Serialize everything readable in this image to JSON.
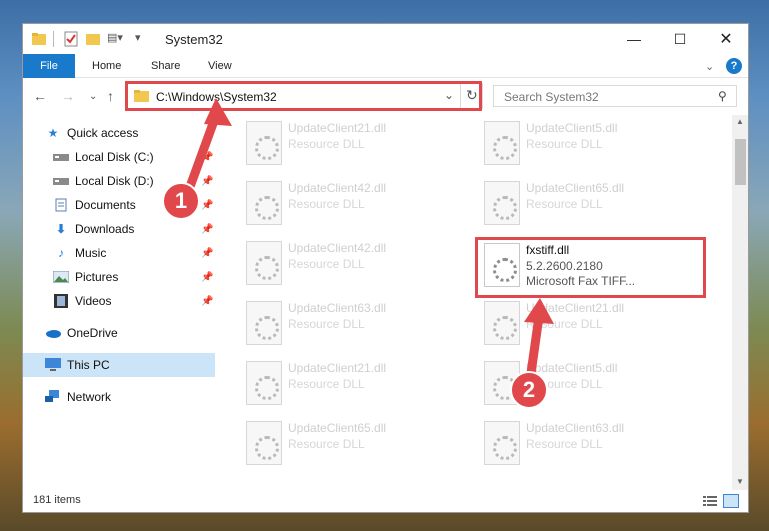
{
  "window": {
    "title": "System32"
  },
  "ribbon": {
    "file": "File",
    "tabs": [
      "Home",
      "Share",
      "View"
    ],
    "help": "?"
  },
  "navbar": {
    "path": "C:\\Windows\\System32",
    "search_placeholder": "Search System32"
  },
  "sidebar": {
    "items": [
      {
        "label": "Quick access",
        "icon": "star-icon"
      },
      {
        "label": "Local Disk (C:)",
        "icon": "drive-icon"
      },
      {
        "label": "Local Disk (D:)",
        "icon": "drive-icon"
      },
      {
        "label": "Documents",
        "icon": "documents-icon"
      },
      {
        "label": "Downloads",
        "icon": "download-icon"
      },
      {
        "label": "Music",
        "icon": "music-icon"
      },
      {
        "label": "Pictures",
        "icon": "pictures-icon"
      },
      {
        "label": "Videos",
        "icon": "videos-icon"
      },
      {
        "label": "OneDrive",
        "icon": "cloud-icon"
      },
      {
        "label": "This PC",
        "icon": "computer-icon"
      },
      {
        "label": "Network",
        "icon": "network-icon"
      }
    ]
  },
  "files": {
    "left": [
      {
        "name": "UpdateClient21.dll",
        "type": "Resource DLL"
      },
      {
        "name": "UpdateClient42.dll",
        "type": "Resource DLL"
      },
      {
        "name": "UpdateClient42.dll",
        "type": "Resource DLL"
      },
      {
        "name": "UpdateClient63.dll",
        "type": "Resource DLL"
      },
      {
        "name": "UpdateClient21.dll",
        "type": "Resource DLL"
      },
      {
        "name": "UpdateClient65.dll",
        "type": "Resource DLL"
      }
    ],
    "right": [
      {
        "name": "UpdateClient5.dll",
        "type": "Resource DLL"
      },
      {
        "name": "UpdateClient65.dll",
        "type": "Resource DLL"
      },
      {
        "name": "UpdateClient21.dll",
        "type": "Resource DLL"
      },
      {
        "name": "UpdateClient5.dll",
        "type": "Resource DLL"
      },
      {
        "name": "UpdateClient63.dll",
        "type": "Resource DLL"
      }
    ],
    "highlighted": {
      "name": "fxstiff.dll",
      "version": "5.2.2600.2180",
      "desc": "Microsoft  Fax TIFF..."
    }
  },
  "status": {
    "count": "181 items"
  },
  "annotations": {
    "step1": "1",
    "step2": "2",
    "accent": "#e0484b"
  }
}
